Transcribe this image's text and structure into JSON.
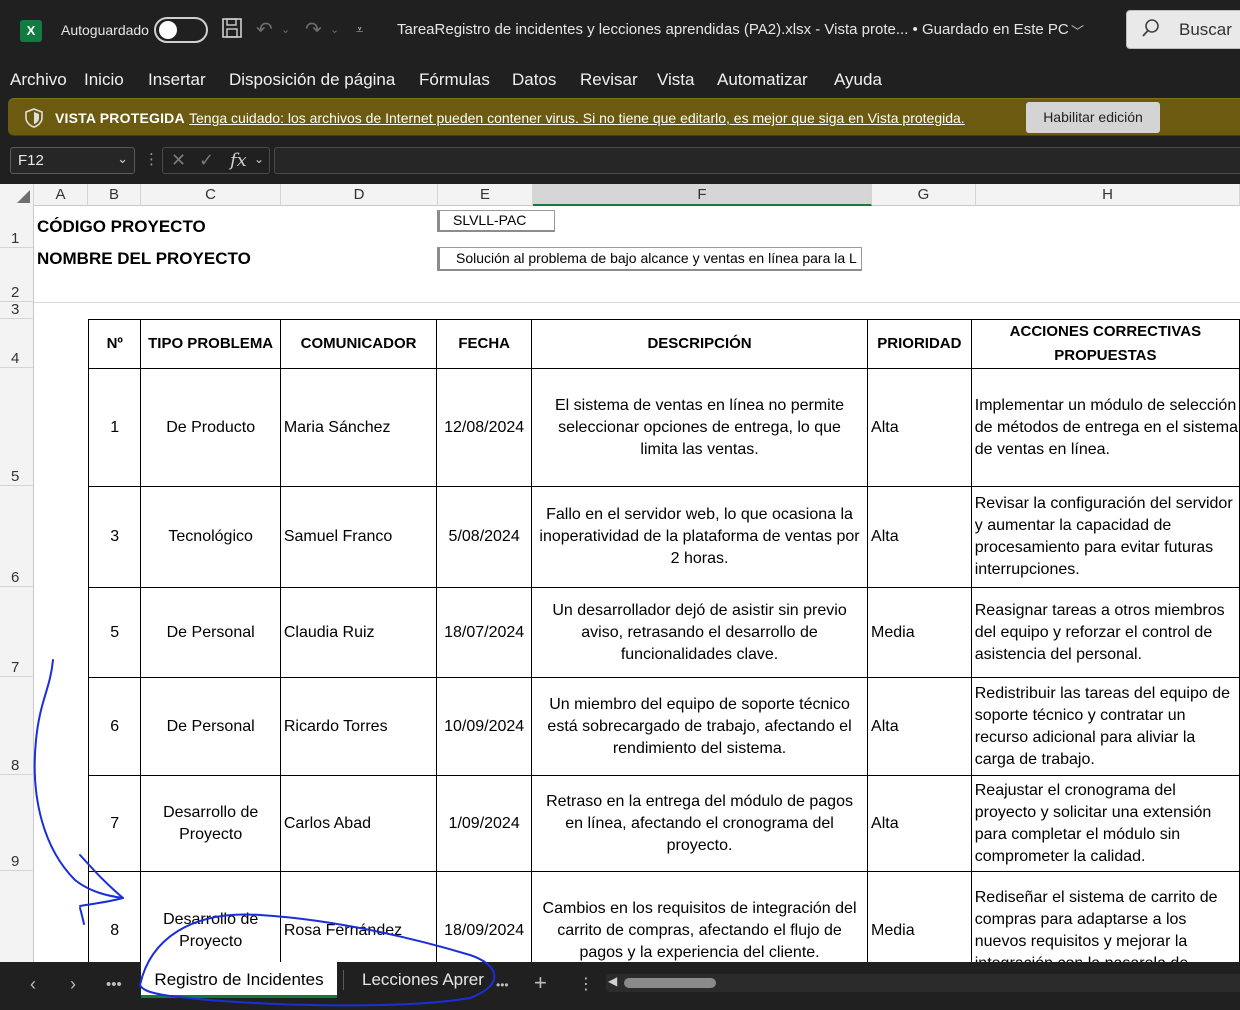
{
  "titlebar": {
    "logo": "X",
    "autosave_label": "Autoguardado",
    "autosave_on": false,
    "document_title": "TareaRegistro de incidentes y lecciones aprendidas (PA2).xlsx  -  Vista prote...  •  Guardado en Este PC",
    "search_label": "Buscar"
  },
  "menu": [
    "Archivo",
    "Inicio",
    "Insertar",
    "Disposición de página",
    "Fórmulas",
    "Datos",
    "Revisar",
    "Vista",
    "Automatizar",
    "Ayuda"
  ],
  "protected_view": {
    "title": "VISTA PROTEGIDA",
    "message": "Tenga cuidado: los archivos de Internet pueden contener virus. Si no tiene que editarlo, es mejor que siga en Vista protegida.",
    "button": "Habilitar edición"
  },
  "formula_bar": {
    "name_box": "F12",
    "fx": "fx",
    "value": ""
  },
  "columns": [
    "A",
    "B",
    "C",
    "D",
    "E",
    "F",
    "G",
    "H"
  ],
  "selected_column": "F",
  "rows": [
    "1",
    "2",
    "3",
    "4",
    "5",
    "6",
    "7",
    "8",
    "9"
  ],
  "project": {
    "code_label": "CÓDIGO PROYECTO",
    "code_value": "SLVLL-PAC",
    "name_label": "NOMBRE DEL PROYECTO",
    "name_value": "Solución al problema de bajo alcance y ventas en línea para la L"
  },
  "table": {
    "headers": [
      "Nº",
      "TIPO PROBLEMA",
      "COMUNICADOR",
      "FECHA",
      "DESCRIPCIÓN",
      "PRIORIDAD",
      "ACCIONES CORRECTIVAS PROPUESTAS"
    ],
    "rows": [
      [
        "1",
        "De Producto",
        "Maria Sánchez",
        "12/08/2024",
        "El sistema de ventas en línea no permite seleccionar opciones de entrega, lo que limita las ventas.",
        "Alta",
        "Implementar un módulo de selección de métodos de entrega en el sistema de ventas en línea."
      ],
      [
        "3",
        "Tecnológico",
        "Samuel Franco",
        "5/08/2024",
        "Fallo en el servidor web, lo que ocasiona la inoperatividad de la plataforma de ventas por 2 horas.",
        "Alta",
        "Revisar la configuración del servidor y aumentar la capacidad de procesamiento para evitar futuras interrupciones."
      ],
      [
        "5",
        "De Personal",
        "Claudia Ruiz",
        "18/07/2024",
        "Un desarrollador dejó de asistir sin previo aviso, retrasando el desarrollo de funcionalidades clave.",
        "Media",
        "Reasignar tareas a otros miembros del equipo y reforzar el control de asistencia del personal."
      ],
      [
        "6",
        "De Personal",
        "Ricardo Torres",
        "10/09/2024",
        "Un miembro del equipo de soporte técnico está sobrecargado de trabajo, afectando el rendimiento del sistema.",
        "Alta",
        "Redistribuir las tareas del equipo de soporte técnico y contratar un recurso adicional para aliviar la carga de trabajo."
      ],
      [
        "7",
        "Desarrollo de Proyecto",
        "Carlos Abad",
        "1/09/2024",
        "Retraso en la entrega del módulo de pagos en línea, afectando el cronograma del proyecto.",
        "Alta",
        "Reajustar el cronograma del proyecto y solicitar una extensión para completar el módulo sin comprometer la calidad."
      ],
      [
        "8",
        "Desarrollo de Proyecto",
        "Rosa Fernández",
        "18/09/2024",
        "Cambios en los requisitos de integración del carrito de compras, afectando el flujo de pagos y la experiencia del cliente.",
        "Media",
        "Rediseñar el sistema de carrito de compras para adaptarse a los nuevos requisitos y mejorar la integración con la pasarela de"
      ]
    ]
  },
  "sheet_tabs": {
    "active": "Registro de Incidentes",
    "inactive": "Lecciones Aprer",
    "add": "+"
  },
  "colors": {
    "excel_green": "#107c41",
    "protected_bar": "#6b5a10",
    "annotation_ink": "#1a2fd8"
  },
  "icons": [
    "excel-logo-icon",
    "save-icon",
    "undo-icon",
    "redo-icon",
    "customize-qat-icon",
    "chevron-down-icon",
    "search-icon",
    "shield-icon",
    "cancel-icon",
    "enter-icon",
    "fx-icon",
    "select-all-icon",
    "prev-sheet-icon",
    "next-sheet-icon",
    "more-sheets-icon",
    "add-sheet-icon"
  ]
}
